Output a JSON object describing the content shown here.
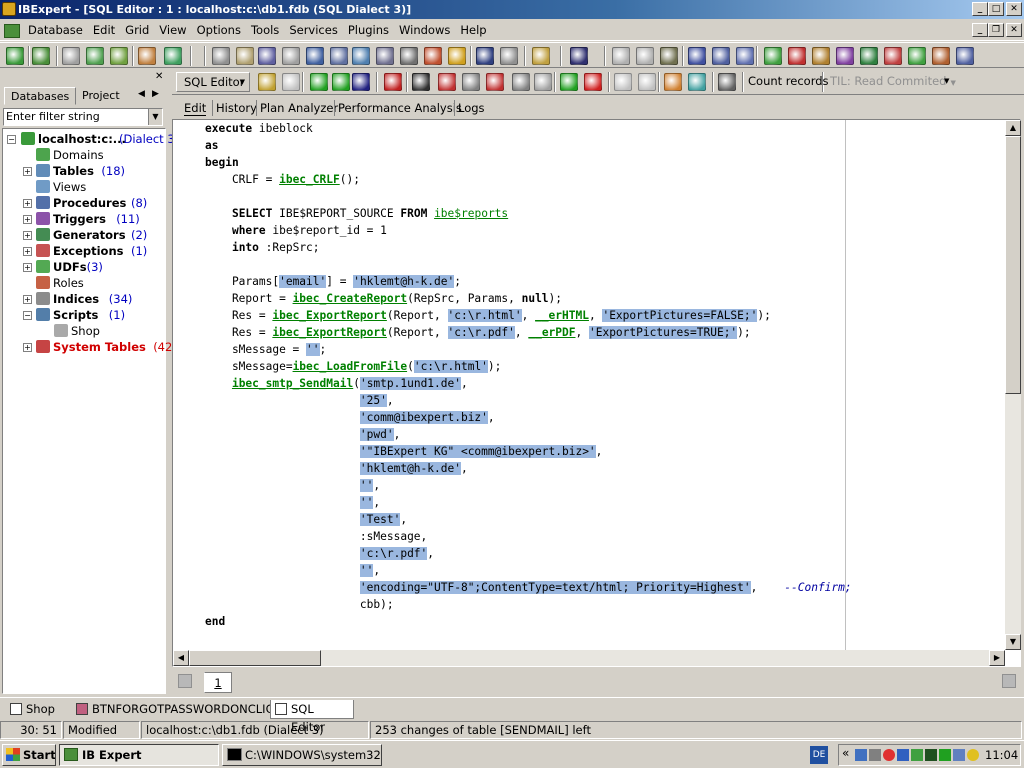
{
  "window": {
    "title": "IBExpert - [SQL Editor : 1 : localhost:c:\\db1.fdb (SQL Dialect 3)]"
  },
  "menu": {
    "items": [
      "Database",
      "Edit",
      "Grid",
      "View",
      "Options",
      "Tools",
      "Services",
      "Plugins",
      "Windows",
      "Help"
    ]
  },
  "left_panel": {
    "tabs": [
      "Databases",
      "Project"
    ],
    "filter_placeholder": "Enter filter string",
    "db": {
      "name": "localhost:c:...",
      "dialect": "(Dialect 3)"
    },
    "nodes": [
      {
        "label": "Domains",
        "count": "",
        "bold": false,
        "expandable": false
      },
      {
        "label": "Tables",
        "count": "(18)",
        "bold": true,
        "expandable": true
      },
      {
        "label": "Views",
        "count": "",
        "bold": false,
        "expandable": false
      },
      {
        "label": "Procedures",
        "count": "(8)",
        "bold": true,
        "expandable": true
      },
      {
        "label": "Triggers",
        "count": "(11)",
        "bold": true,
        "expandable": true
      },
      {
        "label": "Generators",
        "count": "(2)",
        "bold": true,
        "expandable": true
      },
      {
        "label": "Exceptions",
        "count": "(1)",
        "bold": true,
        "expandable": true
      },
      {
        "label": "UDFs",
        "count": "(3)",
        "bold": true,
        "expandable": true
      },
      {
        "label": "Roles",
        "count": "",
        "bold": false,
        "expandable": false
      },
      {
        "label": "Indices",
        "count": "(34)",
        "bold": true,
        "expandable": true
      },
      {
        "label": "Scripts",
        "count": "(1)",
        "bold": true,
        "expandable": true
      },
      {
        "label": "Shop",
        "count": "",
        "bold": false,
        "expandable": false
      },
      {
        "label": "System Tables",
        "count": "(42)",
        "bold": true,
        "expandable": true
      }
    ]
  },
  "sql_toolbar": {
    "sql_editor": "SQL Editor",
    "count_records": "Count records",
    "til": "TIL: Read Commited"
  },
  "subtabs": [
    "Edit",
    "History",
    "Plan Analyzer",
    "Performance Analysis",
    "Logs"
  ],
  "code_tokens": [
    [
      [
        "k",
        "execute"
      ],
      [
        "n",
        " ibeblock"
      ]
    ],
    [
      [
        "k",
        "as"
      ]
    ],
    [
      [
        "k",
        "begin"
      ]
    ],
    [
      [
        "n",
        "    CRLF = "
      ],
      [
        "f",
        "ibec_CRLF"
      ],
      [
        "n",
        "();"
      ]
    ],
    [],
    [
      [
        "n",
        "    "
      ],
      [
        "k",
        "SELECT"
      ],
      [
        "n",
        " IBE$REPORT_SOURCE "
      ],
      [
        "k",
        "FROM"
      ],
      [
        "n",
        " "
      ],
      [
        "t",
        "ibe$reports"
      ]
    ],
    [
      [
        "n",
        "    "
      ],
      [
        "k",
        "where"
      ],
      [
        "n",
        " ibe$report_id = 1"
      ]
    ],
    [
      [
        "n",
        "    "
      ],
      [
        "k",
        "into"
      ],
      [
        "n",
        " :RepSrc;"
      ]
    ],
    [],
    [
      [
        "n",
        "    Params["
      ],
      [
        "h",
        "'email'"
      ],
      [
        "n",
        "] = "
      ],
      [
        "h",
        "'hklemt@h-k.de'"
      ],
      [
        "n",
        ";"
      ]
    ],
    [
      [
        "n",
        "    Report = "
      ],
      [
        "f",
        "ibec_CreateReport"
      ],
      [
        "n",
        "(RepSrc, Params, "
      ],
      [
        "k",
        "null"
      ],
      [
        "n",
        ");"
      ]
    ],
    [
      [
        "n",
        "    Res = "
      ],
      [
        "f",
        "ibec_ExportReport"
      ],
      [
        "n",
        "(Report, "
      ],
      [
        "h",
        "'c:\\r.html'"
      ],
      [
        "n",
        ", "
      ],
      [
        "f",
        "__erHTML"
      ],
      [
        "n",
        ", "
      ],
      [
        "h",
        "'ExportPictures=FALSE;'"
      ],
      [
        "n",
        ");"
      ]
    ],
    [
      [
        "n",
        "    Res = "
      ],
      [
        "f",
        "ibec_ExportReport"
      ],
      [
        "n",
        "(Report, "
      ],
      [
        "h",
        "'c:\\r.pdf'"
      ],
      [
        "n",
        ", "
      ],
      [
        "f",
        "__erPDF"
      ],
      [
        "n",
        ", "
      ],
      [
        "h",
        "'ExportPictures=TRUE;'"
      ],
      [
        "n",
        ");"
      ]
    ],
    [
      [
        "n",
        "    sMessage = "
      ],
      [
        "h",
        "''"
      ],
      [
        "n",
        ";"
      ]
    ],
    [
      [
        "n",
        "    sMessage="
      ],
      [
        "f",
        "ibec_LoadFromFile"
      ],
      [
        "n",
        "("
      ],
      [
        "h",
        "'c:\\r.html'"
      ],
      [
        "n",
        ");"
      ]
    ],
    [
      [
        "n",
        "    "
      ],
      [
        "f",
        "ibec_smtp_SendMail"
      ],
      [
        "n",
        "("
      ],
      [
        "h",
        "'smtp.1und1.de'"
      ],
      [
        "n",
        ","
      ]
    ],
    [
      [
        "n",
        "                       "
      ],
      [
        "h",
        "'25'"
      ],
      [
        "n",
        ","
      ]
    ],
    [
      [
        "n",
        "                       "
      ],
      [
        "h",
        "'comm@ibexpert.biz'"
      ],
      [
        "n",
        ","
      ]
    ],
    [
      [
        "n",
        "                       "
      ],
      [
        "h",
        "'pwd'"
      ],
      [
        "n",
        ","
      ]
    ],
    [
      [
        "n",
        "                       "
      ],
      [
        "h",
        "'\"IBExpert KG\" <comm@ibexpert.biz>'"
      ],
      [
        "n",
        ","
      ]
    ],
    [
      [
        "n",
        "                       "
      ],
      [
        "h",
        "'hklemt@h-k.de'"
      ],
      [
        "n",
        ","
      ]
    ],
    [
      [
        "n",
        "                       "
      ],
      [
        "h",
        "''"
      ],
      [
        "n",
        ","
      ]
    ],
    [
      [
        "n",
        "                       "
      ],
      [
        "h",
        "''"
      ],
      [
        "n",
        ","
      ]
    ],
    [
      [
        "n",
        "                       "
      ],
      [
        "h",
        "'Test'"
      ],
      [
        "n",
        ","
      ]
    ],
    [
      [
        "n",
        "                       :sMessage,"
      ]
    ],
    [
      [
        "n",
        "                       "
      ],
      [
        "h",
        "'c:\\r.pdf'"
      ],
      [
        "n",
        ","
      ]
    ],
    [
      [
        "n",
        "                       "
      ],
      [
        "h",
        "''"
      ],
      [
        "n",
        ","
      ]
    ],
    [
      [
        "n",
        "                       "
      ],
      [
        "h",
        "'encoding=\"UTF-8\";ContentType=text/html; Priority=Highest'"
      ],
      [
        "n",
        ",    "
      ],
      [
        "c",
        "--Confirm;"
      ]
    ],
    [
      [
        "n",
        "                       cbb);"
      ]
    ],
    [
      [
        "k",
        "end"
      ]
    ]
  ],
  "page_tab": "1",
  "doc_tabs": [
    "Shop",
    "BTNFORGOTPASSWORDONCLICK",
    "SQL Editor"
  ],
  "status": {
    "position": "30:  51",
    "state": "Modified",
    "db": "localhost:c:\\db1.fdb (Dialect 3)",
    "message": "253 changes of table [SENDMAIL] left"
  },
  "taskbar": {
    "start": "Start",
    "tasks": [
      "IB Expert",
      "C:\\WINDOWS\\system32..."
    ],
    "lang": "DE",
    "clock": "11:04"
  }
}
